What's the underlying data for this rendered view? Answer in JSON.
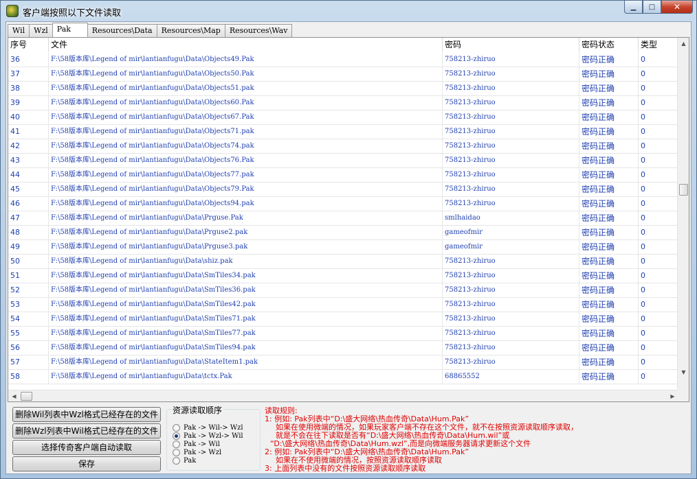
{
  "window": {
    "title": "客户端按照以下文件读取",
    "min_glyph": "▁",
    "max_glyph": "□",
    "close_glyph": "✕"
  },
  "tabs": [
    {
      "label": "Wil",
      "active": false
    },
    {
      "label": "Wzl",
      "active": false
    },
    {
      "label": "Pak",
      "active": true
    },
    {
      "label": "Resources\\Data",
      "active": false
    },
    {
      "label": "Resources\\Map",
      "active": false
    },
    {
      "label": "Resources\\Wav",
      "active": false
    }
  ],
  "grid": {
    "columns": [
      "序号",
      "文件",
      "密码",
      "密码状态",
      "类型"
    ],
    "rows": [
      {
        "no": "36",
        "file": "F:\\58版本库\\Legend of mir\\lantianfugu\\Data\\Objects49.Pak",
        "password": "758213-zhiruo",
        "status": "密码正确",
        "type": "0"
      },
      {
        "no": "37",
        "file": "F:\\58版本库\\Legend of mir\\lantianfugu\\Data\\Objects50.Pak",
        "password": "758213-zhiruo",
        "status": "密码正确",
        "type": "0"
      },
      {
        "no": "38",
        "file": "F:\\58版本库\\Legend of mir\\lantianfugu\\Data\\Objects51.pak",
        "password": "758213-zhiruo",
        "status": "密码正确",
        "type": "0"
      },
      {
        "no": "39",
        "file": "F:\\58版本库\\Legend of mir\\lantianfugu\\Data\\Objects60.Pak",
        "password": "758213-zhiruo",
        "status": "密码正确",
        "type": "0"
      },
      {
        "no": "40",
        "file": "F:\\58版本库\\Legend of mir\\lantianfugu\\Data\\Objects67.Pak",
        "password": "758213-zhiruo",
        "status": "密码正确",
        "type": "0"
      },
      {
        "no": "41",
        "file": "F:\\58版本库\\Legend of mir\\lantianfugu\\Data\\Objects71.pak",
        "password": "758213-zhiruo",
        "status": "密码正确",
        "type": "0"
      },
      {
        "no": "42",
        "file": "F:\\58版本库\\Legend of mir\\lantianfugu\\Data\\Objects74.pak",
        "password": "758213-zhiruo",
        "status": "密码正确",
        "type": "0"
      },
      {
        "no": "43",
        "file": "F:\\58版本库\\Legend of mir\\lantianfugu\\Data\\Objects76.Pak",
        "password": "758213-zhiruo",
        "status": "密码正确",
        "type": "0"
      },
      {
        "no": "44",
        "file": "F:\\58版本库\\Legend of mir\\lantianfugu\\Data\\Objects77.pak",
        "password": "758213-zhiruo",
        "status": "密码正确",
        "type": "0"
      },
      {
        "no": "45",
        "file": "F:\\58版本库\\Legend of mir\\lantianfugu\\Data\\Objects79.Pak",
        "password": "758213-zhiruo",
        "status": "密码正确",
        "type": "0"
      },
      {
        "no": "46",
        "file": "F:\\58版本库\\Legend of mir\\lantianfugu\\Data\\Objects94.pak",
        "password": "758213-zhiruo",
        "status": "密码正确",
        "type": "0"
      },
      {
        "no": "47",
        "file": "F:\\58版本库\\Legend of mir\\lantianfugu\\Data\\Prguse.Pak",
        "password": "smlhaidao",
        "status": "密码正确",
        "type": "0"
      },
      {
        "no": "48",
        "file": "F:\\58版本库\\Legend of mir\\lantianfugu\\Data\\Prguse2.pak",
        "password": "gameofmir",
        "status": "密码正确",
        "type": "0"
      },
      {
        "no": "49",
        "file": "F:\\58版本库\\Legend of mir\\lantianfugu\\Data\\Prguse3.pak",
        "password": "gameofmir",
        "status": "密码正确",
        "type": "0"
      },
      {
        "no": "50",
        "file": "F:\\58版本库\\Legend of mir\\lantianfugu\\Data\\shiz.pak",
        "password": "758213-zhiruo",
        "status": "密码正确",
        "type": "0"
      },
      {
        "no": "51",
        "file": "F:\\58版本库\\Legend of mir\\lantianfugu\\Data\\SmTiles34.pak",
        "password": "758213-zhiruo",
        "status": "密码正确",
        "type": "0"
      },
      {
        "no": "52",
        "file": "F:\\58版本库\\Legend of mir\\lantianfugu\\Data\\SmTiles36.pak",
        "password": "758213-zhiruo",
        "status": "密码正确",
        "type": "0"
      },
      {
        "no": "53",
        "file": "F:\\58版本库\\Legend of mir\\lantianfugu\\Data\\SmTiles42.pak",
        "password": "758213-zhiruo",
        "status": "密码正确",
        "type": "0"
      },
      {
        "no": "54",
        "file": "F:\\58版本库\\Legend of mir\\lantianfugu\\Data\\SmTiles71.pak",
        "password": "758213-zhiruo",
        "status": "密码正确",
        "type": "0"
      },
      {
        "no": "55",
        "file": "F:\\58版本库\\Legend of mir\\lantianfugu\\Data\\SmTiles77.pak",
        "password": "758213-zhiruo",
        "status": "密码正确",
        "type": "0"
      },
      {
        "no": "56",
        "file": "F:\\58版本库\\Legend of mir\\lantianfugu\\Data\\SmTiles94.pak",
        "password": "758213-zhiruo",
        "status": "密码正确",
        "type": "0"
      },
      {
        "no": "57",
        "file": "F:\\58版本库\\Legend of mir\\lantianfugu\\Data\\StateItem1.pak",
        "password": "758213-zhiruo",
        "status": "密码正确",
        "type": "0"
      },
      {
        "no": "58",
        "file": "F:\\58版本库\\Legend of mir\\lantianfugu\\Data\\tctx.Pak",
        "password": "68865552",
        "status": "密码正确",
        "type": "0"
      }
    ]
  },
  "buttons": {
    "delete_wil": "删除Wil列表中Wzl格式已经存在的文件",
    "delete_wzl": "删除Wzl列表中Wil格式已经存在的文件",
    "auto_read": "选择传奇客户端自动读取",
    "save": "保存"
  },
  "read_order": {
    "title": "资源读取顺序",
    "options": [
      {
        "label": "Pak -> Wil-> Wzl",
        "selected": false
      },
      {
        "label": "Pak -> Wzl-> Wil",
        "selected": true
      },
      {
        "label": "Pak -> Wil",
        "selected": false
      },
      {
        "label": "Pak -> Wzl",
        "selected": false
      },
      {
        "label": "Pak",
        "selected": false
      }
    ]
  },
  "rules": {
    "title": "读取规则:",
    "lines": [
      "1: 例如: Pak列表中“D:\\盛大网络\\热血传奇\\Data\\Hum.Pak”",
      "如果在使用微端的情况，如果玩家客户端不存在这个文件，就不在按照资源读取顺序读取，",
      "就是不会在往下读取是否有“D:\\盛大网络\\热血传奇\\Data\\Hum.wil”或",
      "“D:\\盛大网络\\热血传奇\\Data\\Hum.wzl”,而是向微端服务器请求更新这个文件",
      "2: 例如: Pak列表中“D:\\盛大网络\\热血传奇\\Data\\Hum.Pak”",
      "如果在不使用微端的情况，按照资源读取顺序读取",
      "3: 上面列表中没有的文件按照资源读取顺序读取"
    ]
  },
  "colors": {
    "grid_text": "#1f3fb0",
    "rules_text": "#e00000",
    "titlebar": "#a9c4e0"
  }
}
